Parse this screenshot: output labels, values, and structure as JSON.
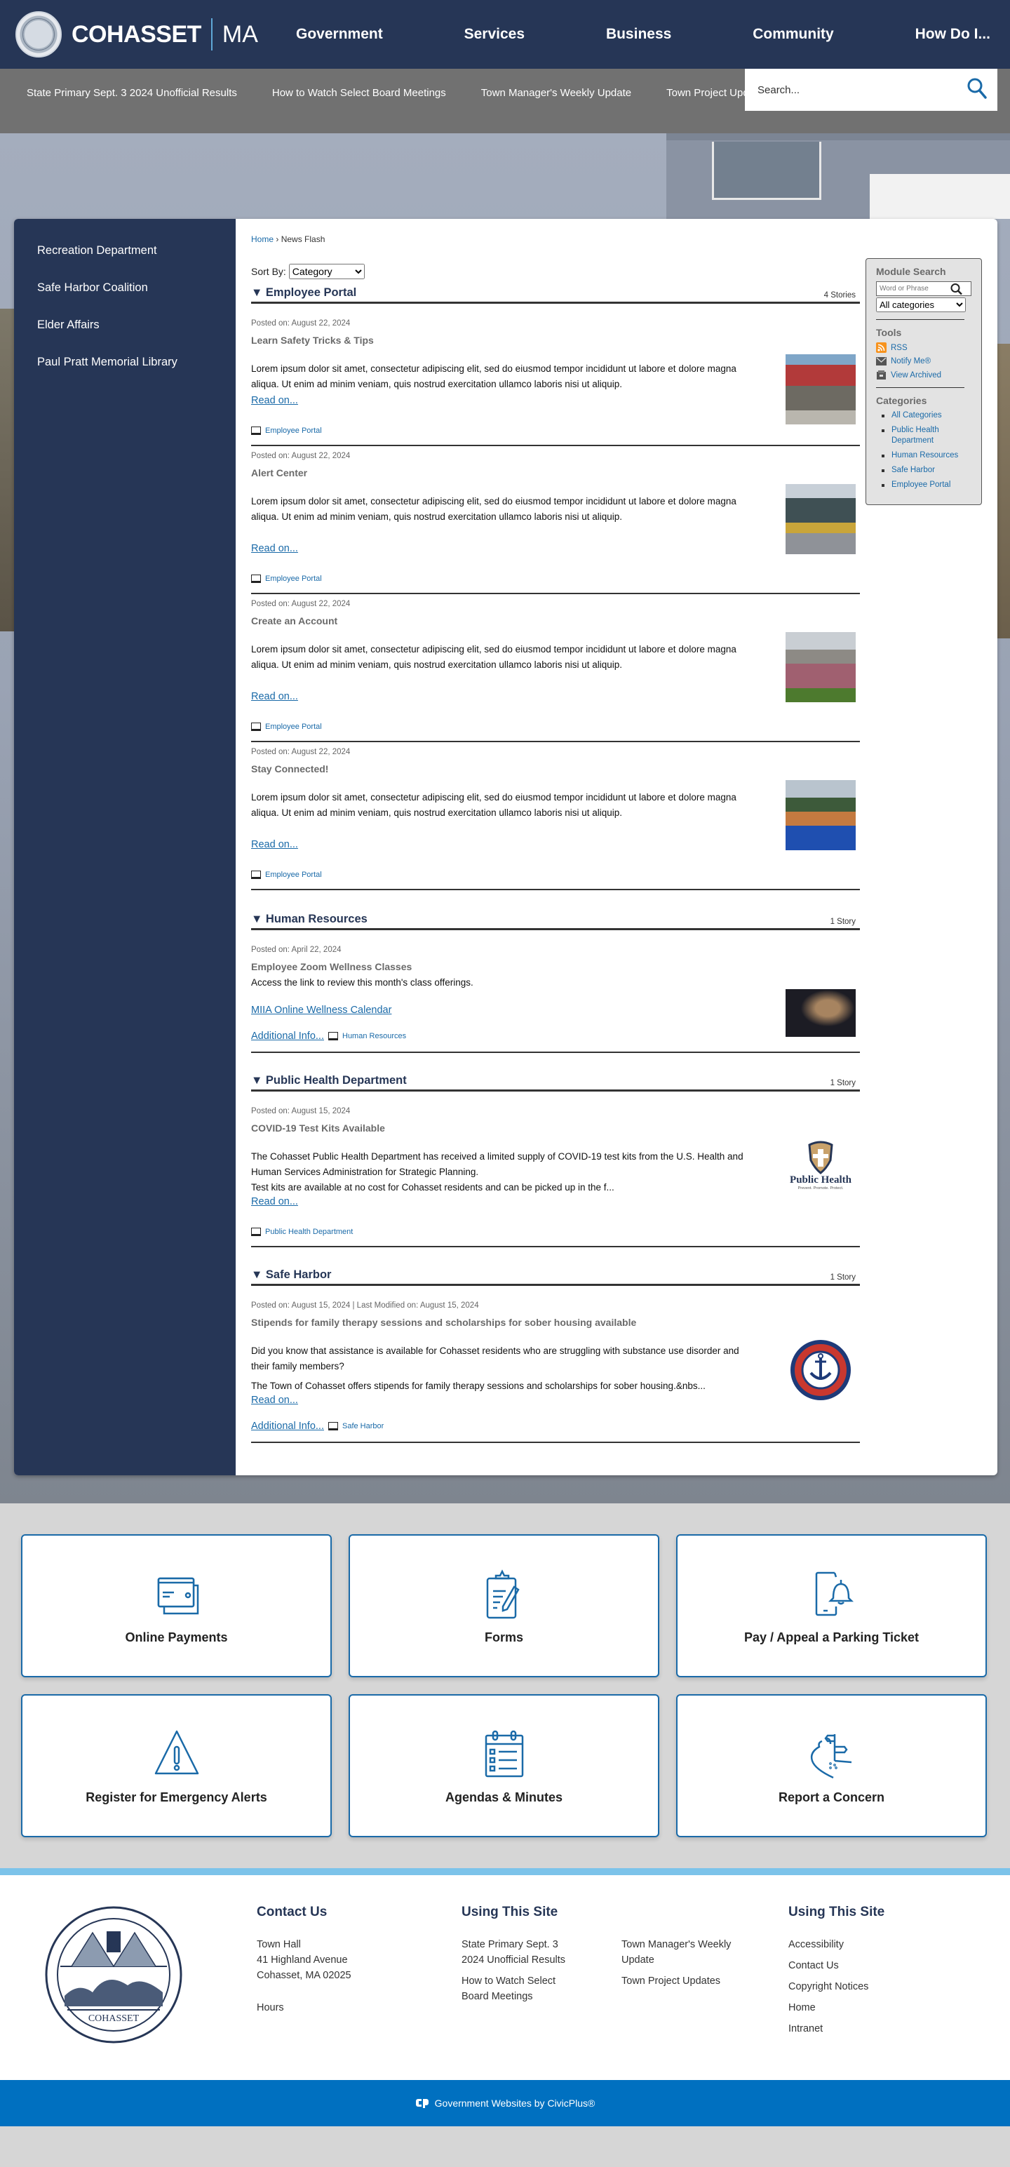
{
  "header": {
    "site_name": "COHASSET",
    "state": "MA",
    "nav": [
      "Government",
      "Services",
      "Business",
      "Community",
      "How Do I..."
    ]
  },
  "subbar": {
    "quick_links": [
      "State Primary Sept. 3 2024 Unofficial Results",
      "How to Watch Select Board Meetings",
      "Town Manager's Weekly Update",
      "Town Project Updates"
    ],
    "search_placeholder": "Search..."
  },
  "sidenav": {
    "items": [
      "Recreation Department",
      "Safe Harbor Coalition",
      "Elder Affairs",
      "Paul Pratt Memorial Library"
    ]
  },
  "breadcrumb": {
    "home": "Home",
    "separator": "›",
    "current": "News Flash"
  },
  "sort": {
    "label": "Sort By:",
    "selected": "Category"
  },
  "categories": [
    {
      "title": "Employee Portal",
      "count": "4 Stories",
      "items": [
        {
          "posted": "Posted on: August 22, 2024",
          "title": "Learn Safety Tricks & Tips",
          "body": "Lorem ipsum dolor sit amet, consectetur adipiscing elit, sed do eiusmod tempor incididunt ut labore et dolore magna aliqua. Ut enim ad minim veniam, quis nostrud exercitation ullamco laboris nisi ut aliquip.",
          "read_on": "Read on...",
          "category": "Employee Portal",
          "image": "fire-truck-crowd-photo"
        },
        {
          "posted": "Posted on: August 22, 2024",
          "title": "Alert Center",
          "body": "Lorem ipsum dolor sit amet, consectetur adipiscing elit, sed do eiusmod tempor incididunt ut labore et dolore magna aliqua. Ut enim ad minim veniam, quis nostrud exercitation ullamco laboris nisi ut aliquip.",
          "read_on": "Read on...",
          "category": "Employee Portal",
          "image": "excavator-photo"
        },
        {
          "posted": "Posted on: August 22, 2024",
          "title": "Create an Account",
          "body": "Lorem ipsum dolor sit amet, consectetur adipiscing elit, sed do eiusmod tempor incididunt ut labore et dolore magna aliqua. Ut enim ad minim veniam, quis nostrud exercitation ullamco laboris nisi ut aliquip.",
          "read_on": "Read on...",
          "category": "Employee Portal",
          "image": "flag-field-photo"
        },
        {
          "posted": "Posted on: August 22, 2024",
          "title": "Stay Connected!",
          "body": "Lorem ipsum dolor sit amet, consectetur adipiscing elit, sed do eiusmod tempor incididunt ut labore et dolore magna aliqua. Ut enim ad minim veniam, quis nostrud exercitation ullamco laboris nisi ut aliquip.",
          "read_on": "Read on...",
          "category": "Employee Portal",
          "image": "group-event-photo"
        }
      ]
    },
    {
      "title": "Human Resources",
      "count": "1 Story",
      "items": [
        {
          "posted": "Posted on: April 22, 2024",
          "title": "Employee Zoom Wellness Classes",
          "body": "Access the link to review this month's class offerings.",
          "link": "MIIA Online Wellness Calendar",
          "additional": "Additional Info...",
          "category": "Human Resources",
          "image": "yoga-photo"
        }
      ]
    },
    {
      "title": "Public Health Department",
      "count": "1 Story",
      "items": [
        {
          "posted": "Posted on: August 15, 2024",
          "title": "COVID-19 Test Kits Available",
          "body": "The Cohasset Public Health Department has received a limited supply of COVID-19 test kits from the U.S. Health and Human Services Administration for Strategic Planning.",
          "body2": "Test kits are available at no cost for Cohasset residents and can be picked up in the f...",
          "read_on": "Read on...",
          "category": "Public Health Department",
          "logo_title": "Public Health",
          "logo_tagline": "Prevent. Promote. Protect."
        }
      ]
    },
    {
      "title": "Safe Harbor",
      "count": "1 Story",
      "items": [
        {
          "posted": "Posted on: August 15, 2024 | Last Modified on: August 15, 2024",
          "title": "Stipends for family therapy sessions and scholarships for sober housing available",
          "body": "Did you know that assistance is available for Cohasset residents who are struggling with substance use disorder and their family members?",
          "body2": "The Town of Cohasset offers stipends for family therapy sessions and scholarships for sober housing.&nbs...",
          "read_on": "Read on...",
          "additional": "Additional Info...",
          "category": "Safe Harbor",
          "image": "safe-harbor-logo"
        }
      ]
    }
  ],
  "module": {
    "search_title": "Module Search",
    "search_placeholder": "Word or Phrase",
    "category_select": "All categories",
    "tools_title": "Tools",
    "tools": [
      "RSS",
      "Notify Me®",
      "View Archived"
    ],
    "categories_title": "Categories",
    "categories": [
      "All Categories",
      "Public Health Department",
      "Human Resources",
      "Safe Harbor",
      "Employee Portal"
    ]
  },
  "tiles": [
    {
      "label": "Online Payments",
      "icon": "credit-card-icon"
    },
    {
      "label": "Forms",
      "icon": "clipboard-pencil-icon"
    },
    {
      "label": "Pay / Appeal a Parking Ticket",
      "icon": "phone-bell-icon"
    },
    {
      "label": "Register for Emergency Alerts",
      "icon": "warning-triangle-icon"
    },
    {
      "label": "Agendas & Minutes",
      "icon": "calendar-list-icon"
    },
    {
      "label": "Report a Concern",
      "icon": "road-sign-icon"
    }
  ],
  "footer": {
    "contact_title": "Contact Us",
    "contact_lines": [
      "Town Hall",
      "41 Highland Avenue",
      "Cohasset, MA 02025"
    ],
    "hours": "Hours",
    "using_title": "Using This Site",
    "using_links": [
      "State Primary Sept. 3 2024 Unofficial Results",
      "Town Manager's Weekly Update",
      "How to Watch Select Board Meetings",
      "Town Project Updates"
    ],
    "using2_title": "Using This Site",
    "using2_links": [
      "Accessibility",
      "Contact Us",
      "Copyright Notices",
      "Home",
      "Intranet"
    ],
    "credit": "Government Websites by CivicPlus®"
  },
  "colors": {
    "navy": "#263656",
    "link": "#1a6aa8",
    "footer_blue": "#0070c0",
    "stripe": "#7cc3ea"
  }
}
